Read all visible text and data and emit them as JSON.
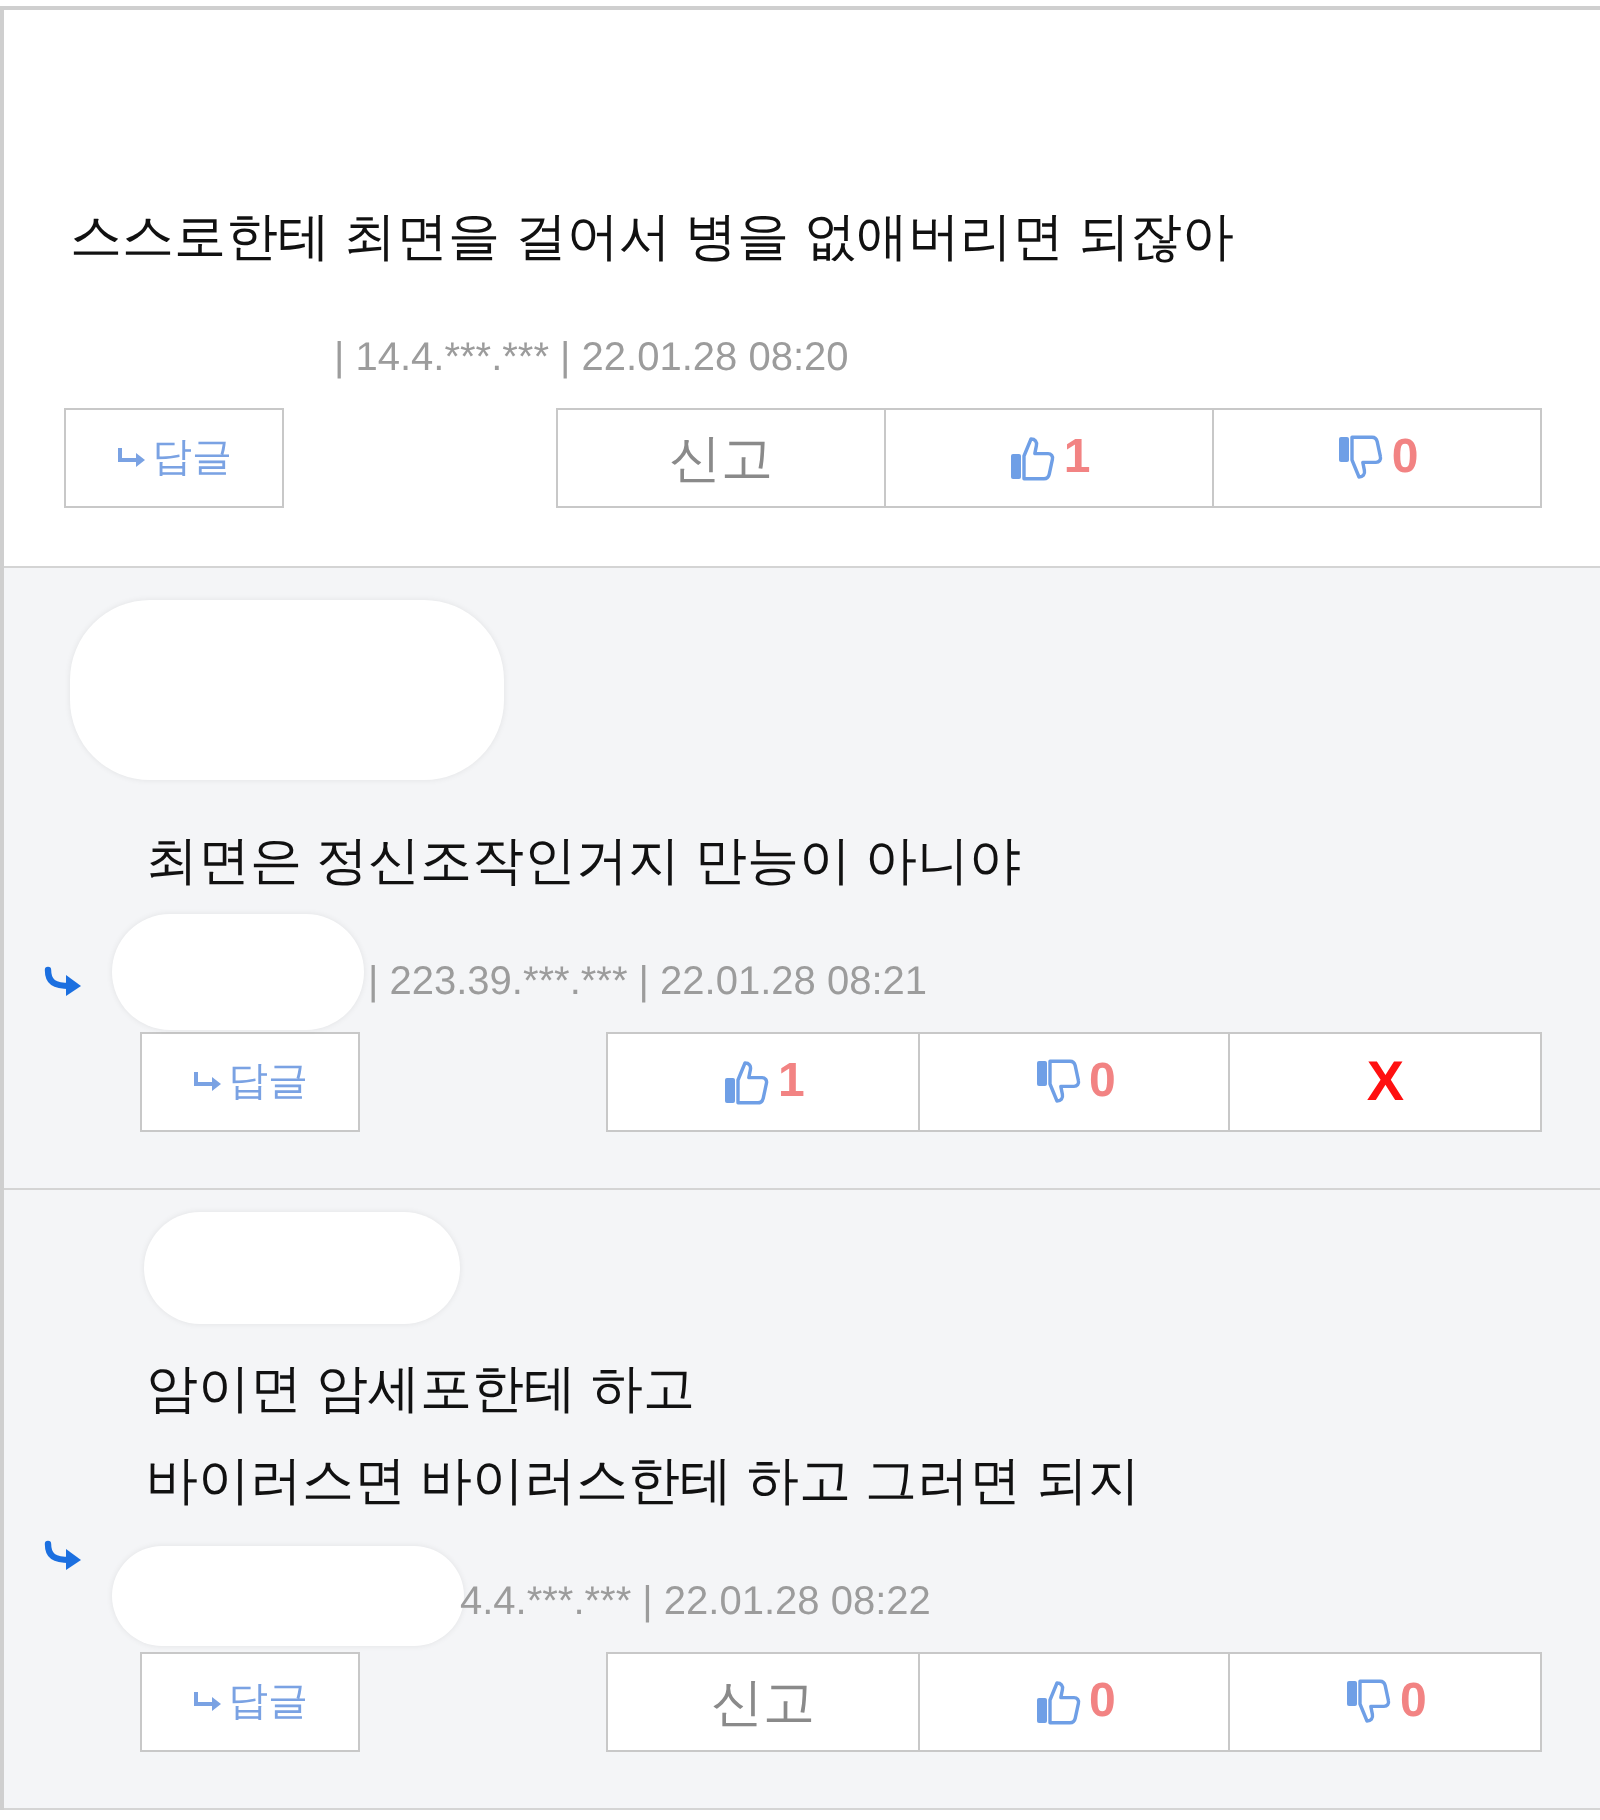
{
  "comments": [
    {
      "is_reply": false,
      "author_redacted": false,
      "text": "스스로한테 최면을 걸어서 병을 없애버리면 되잖아",
      "meta": "| 14.4.***.*** | 22.01.28 08:20",
      "reply_button": {
        "label": "답글"
      },
      "actions": [
        {
          "kind": "report",
          "label": "신고"
        },
        {
          "kind": "like",
          "count": "1"
        },
        {
          "kind": "dislike",
          "count": "0"
        }
      ]
    },
    {
      "is_reply": true,
      "author_redacted": true,
      "text": "최면은 정신조작인거지 만능이 아니야",
      "meta": "| 223.39.***.*** | 22.01.28 08:21",
      "reply_button": {
        "label": "답글"
      },
      "actions": [
        {
          "kind": "like",
          "count": "1"
        },
        {
          "kind": "dislike",
          "count": "0"
        },
        {
          "kind": "delete",
          "label": "X"
        }
      ]
    },
    {
      "is_reply": true,
      "author_redacted": true,
      "text": "암이면 암세포한테 하고\n바이러스면 바이러스한테 하고 그러면 되지",
      "meta": "4.4.***.*** | 22.01.28 08:22",
      "reply_button": {
        "label": "답글"
      },
      "actions": [
        {
          "kind": "report",
          "label": "신고"
        },
        {
          "kind": "like",
          "count": "0"
        },
        {
          "kind": "dislike",
          "count": "0"
        }
      ]
    }
  ]
}
